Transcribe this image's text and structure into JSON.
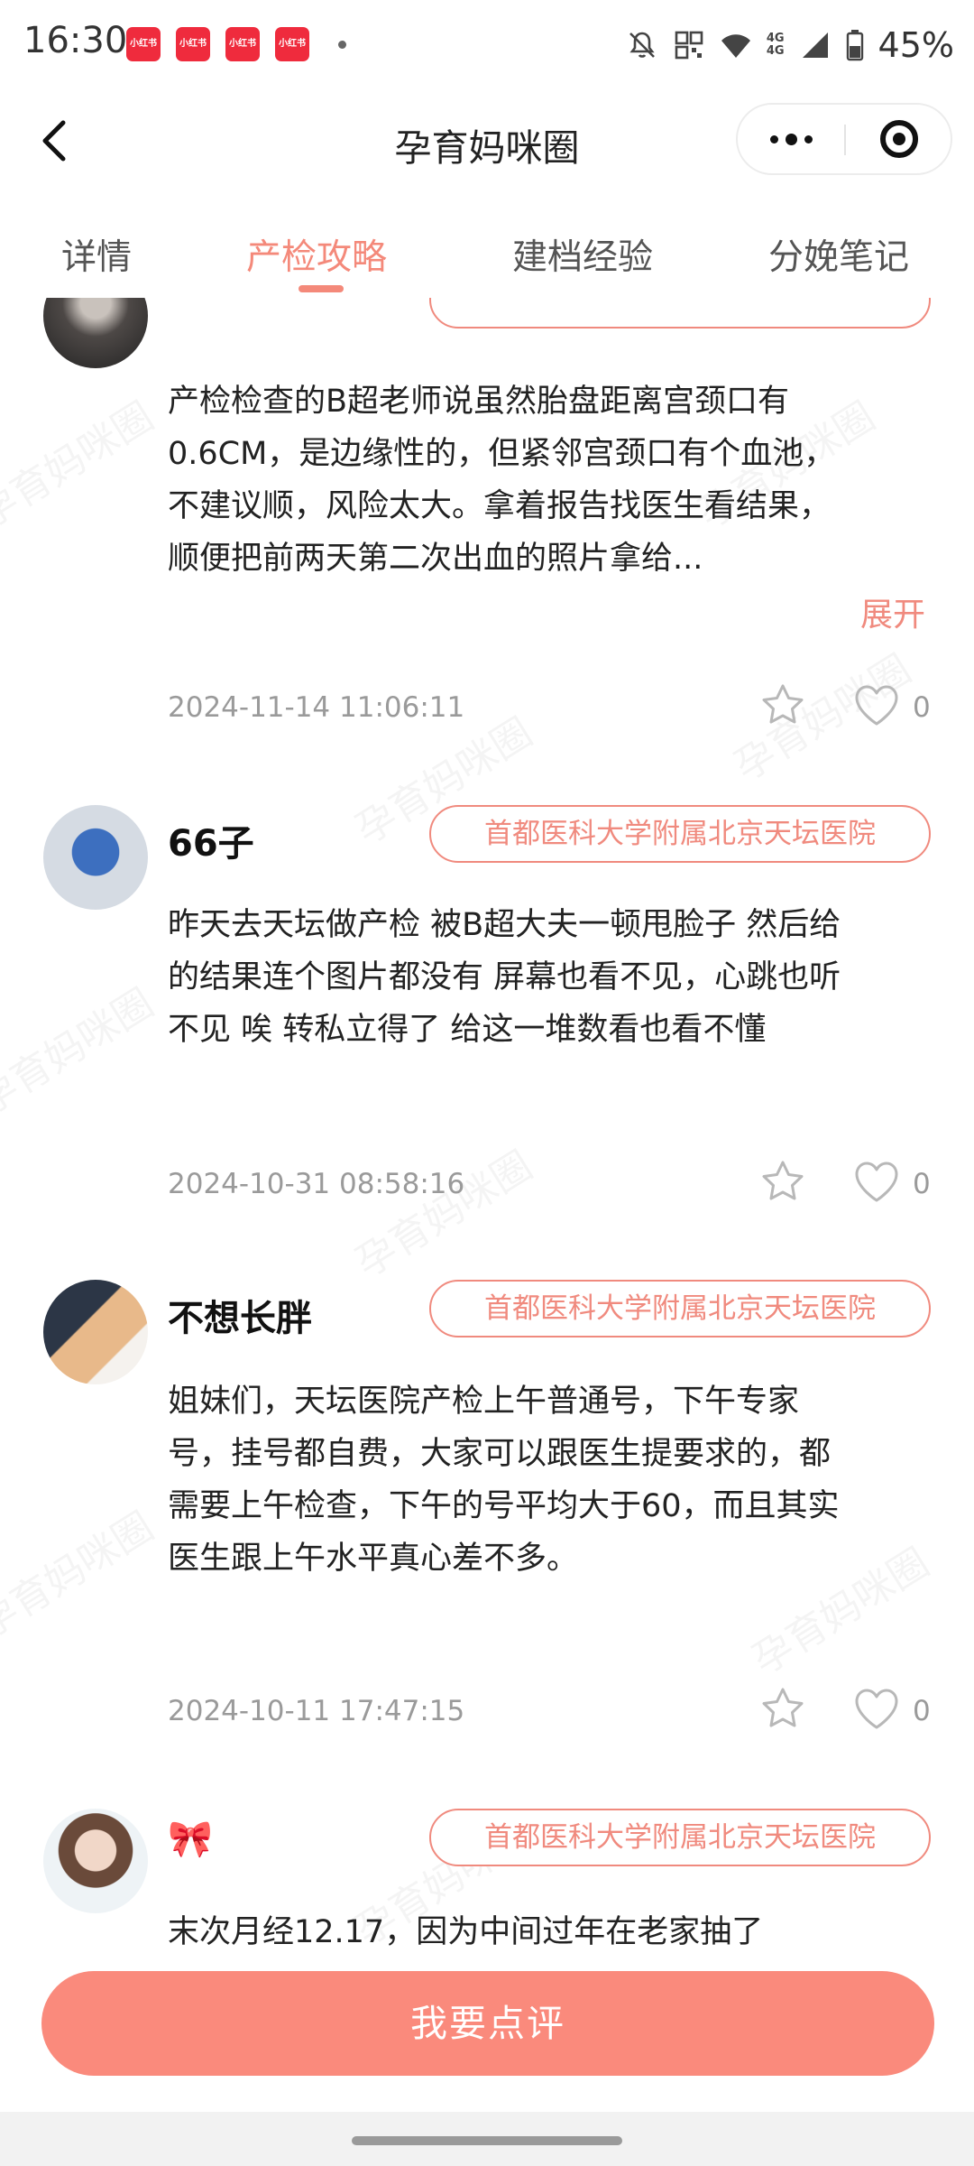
{
  "status_bar": {
    "time": "16:30",
    "app_icons": [
      "小红书",
      "小红书",
      "小红书",
      "小红书"
    ],
    "network": [
      "4G",
      "4G"
    ],
    "battery": "45%",
    "icons": [
      "mute-icon",
      "nfc-icon",
      "wifi-icon",
      "signal-icon",
      "battery-icon"
    ]
  },
  "header": {
    "title": "孕育妈咪圈"
  },
  "tabs": [
    {
      "label": "详情",
      "active": false
    },
    {
      "label": "产检攻略",
      "active": true
    },
    {
      "label": "建档经验",
      "active": false
    },
    {
      "label": "分娩笔记",
      "active": false
    }
  ],
  "watermark": "孕育妈咪圈",
  "posts": [
    {
      "username": "",
      "hospital": "",
      "text": "产检检查的B超老师说虽然胎盘距离宫颈口有0.6CM，是边缘性的，但紧邻宫颈口有个血池，不建议顺，风险太大。拿着报告找医生看结果，顺便把前两天第二次出血的照片拿给...",
      "expand": "展开",
      "time": "2024-11-14 11:06:11",
      "likes": "0"
    },
    {
      "username": "66子",
      "hospital": "首都医科大学附属北京天坛医院",
      "text": "昨天去天坛做产检 被B超大夫一顿甩脸子 然后给的结果连个图片都没有 屏幕也看不见，心跳也听不见 唉 转私立得了 给这一堆数看也看不懂",
      "time": "2024-10-31 08:58:16",
      "likes": "0"
    },
    {
      "username": "不想长胖",
      "hospital": "首都医科大学附属北京天坛医院",
      "text": "姐妹们，天坛医院产检上午普通号，下午专家号，挂号都自费，大家可以跟医生提要求的，都需要上午检查，下午的号平均大于60，而且其实医生跟上午水平真心差不多。",
      "time": "2024-10-11 17:47:15",
      "likes": "0"
    },
    {
      "username": "🎀",
      "hospital": "首都医科大学附属北京天坛医院",
      "text": "末次月经12.17，因为中间过年在老家抽了",
      "time": "",
      "likes": ""
    }
  ],
  "cta": {
    "label": "我要点评"
  },
  "colors": {
    "accent": "#f4897a",
    "cta_bg": "#fa8a7c",
    "meta": "#9a9a9a"
  }
}
